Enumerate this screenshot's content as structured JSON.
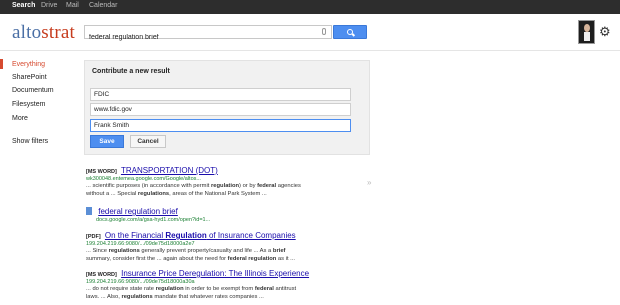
{
  "topbar": {
    "items": [
      "Search",
      "Drive",
      "Mail",
      "Calendar"
    ]
  },
  "logo": {
    "text_main": "alto",
    "text_accent": "strat"
  },
  "search": {
    "value": "federal regulation brief"
  },
  "icons": {
    "mic": "mic-icon",
    "search": "search-icon",
    "gear": "gear-icon",
    "expand": "chevron-right-icon",
    "doc": "document-icon"
  },
  "sidebar": {
    "items": [
      {
        "label": "Everything"
      },
      {
        "label": "SharePoint"
      },
      {
        "label": "Documentum"
      },
      {
        "label": "Filesystem"
      },
      {
        "label": "More"
      }
    ],
    "filters": "Show filters"
  },
  "panel": {
    "title": "Contribute a new result",
    "field1": "FDIC",
    "field2": "www.fdic.gov",
    "field3": "Frank Smith",
    "save_label": "Save",
    "cancel_label": "Cancel"
  },
  "results": [
    {
      "tag": "[MS WORD]",
      "title": "TRANSPORTATION (DOT)",
      "url": "wk300048.entemea.google.com/Google/altos...",
      "snippet1_a": "... scientific purposes (in accordance with permit ",
      "snippet1_b": "regulation",
      "snippet1_c": ") or by ",
      "snippet1_d": "federal",
      "snippet1_e": " agencies",
      "snippet2_a": "without a ... Special ",
      "snippet2_b": "regulations",
      "snippet2_c": ", areas of the National Park System ..."
    },
    {
      "tag": "",
      "title": "federal regulation brief",
      "url": "docs.google.com/a/gsa-hyd1.com/open?id=1..."
    },
    {
      "tag": "[PDF]",
      "title_a": "On the Financial ",
      "title_b": "Regulation",
      "title_c": " of Insurance Companies",
      "url": "199.204.219.66:9080/.../09de75d18000a2e7",
      "snippet1_a": "... Since ",
      "snippet1_b": "regulations",
      "snippet1_c": " generally prevent property/casualty and life ... As a ",
      "snippet1_d": "brief",
      "snippet2_a": "summary, consider first the ... again about the need for ",
      "snippet2_b": "federal regulation",
      "snippet2_c": " as it ..."
    },
    {
      "tag": "[MS WORD]",
      "title": "Insurance Price Deregulation: The Illinois Experience",
      "url": "199.204.219.66:9080/.../09de75d18000a30a",
      "snippet1_a": "... do not require state rate ",
      "snippet1_b": "regulation",
      "snippet1_c": " in order to be exempt from ",
      "snippet1_d": "federal",
      "snippet1_e": " antitrust",
      "snippet2_a": "laws. ... Also, ",
      "snippet2_b": "regulations",
      "snippet2_c": " mandate that whatever rates companies ..."
    }
  ],
  "colors": {
    "accent": "#d64a2f",
    "primary": "#4d8ef0",
    "link": "#1a0dab",
    "url": "#1a7f32",
    "topbar": "#2d2d2d"
  }
}
